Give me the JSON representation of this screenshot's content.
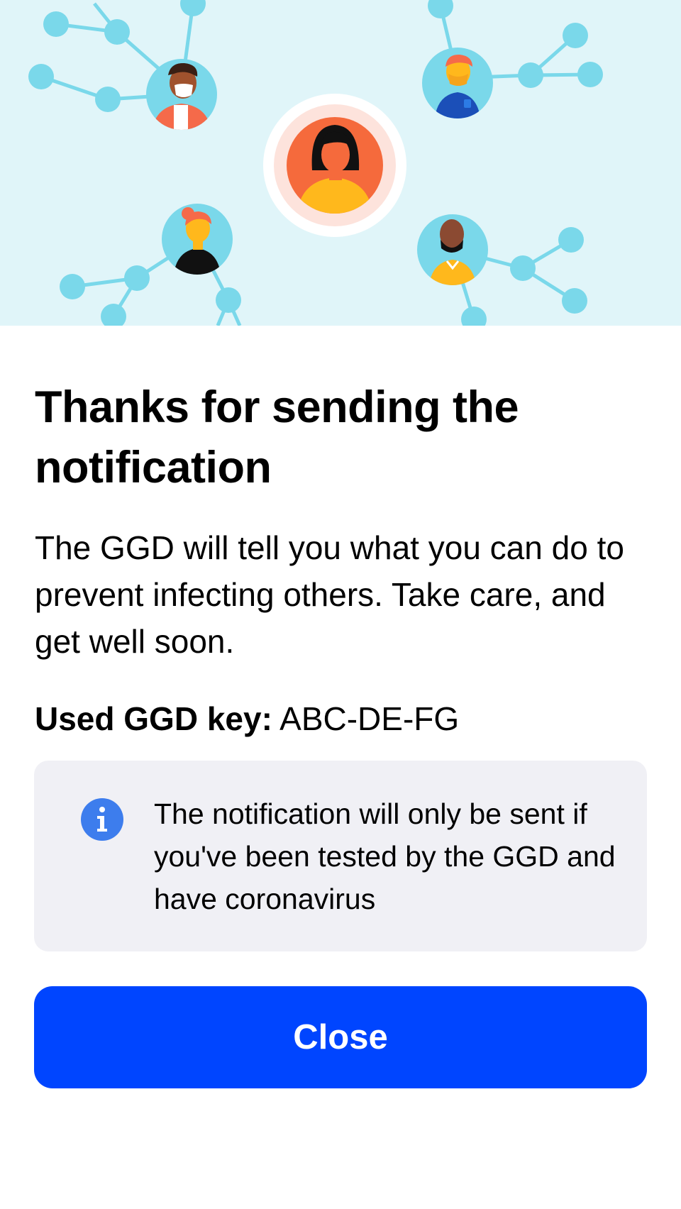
{
  "hero": {
    "illustration": "people-network-illustration",
    "colors": {
      "background": "#e0f5f9",
      "node": "#7ad8ea",
      "highlight_ring": "#fde3dc",
      "highlight_fill": "#f56a3c"
    }
  },
  "content": {
    "title": "Thanks for sending the notification",
    "body": "The GGD will tell you what you can do to prevent infecting others. Take care, and get well soon.",
    "key_label": "Used GGD key:",
    "key_value": "ABC-DE-FG"
  },
  "info": {
    "icon": "info-icon",
    "text": "The notification will only be sent if you've been tested by the GGD and have coronavirus"
  },
  "actions": {
    "close_label": "Close"
  },
  "colors": {
    "primary": "#0045ff",
    "info_background": "#f0f0f5",
    "info_icon": "#3d7ded"
  }
}
